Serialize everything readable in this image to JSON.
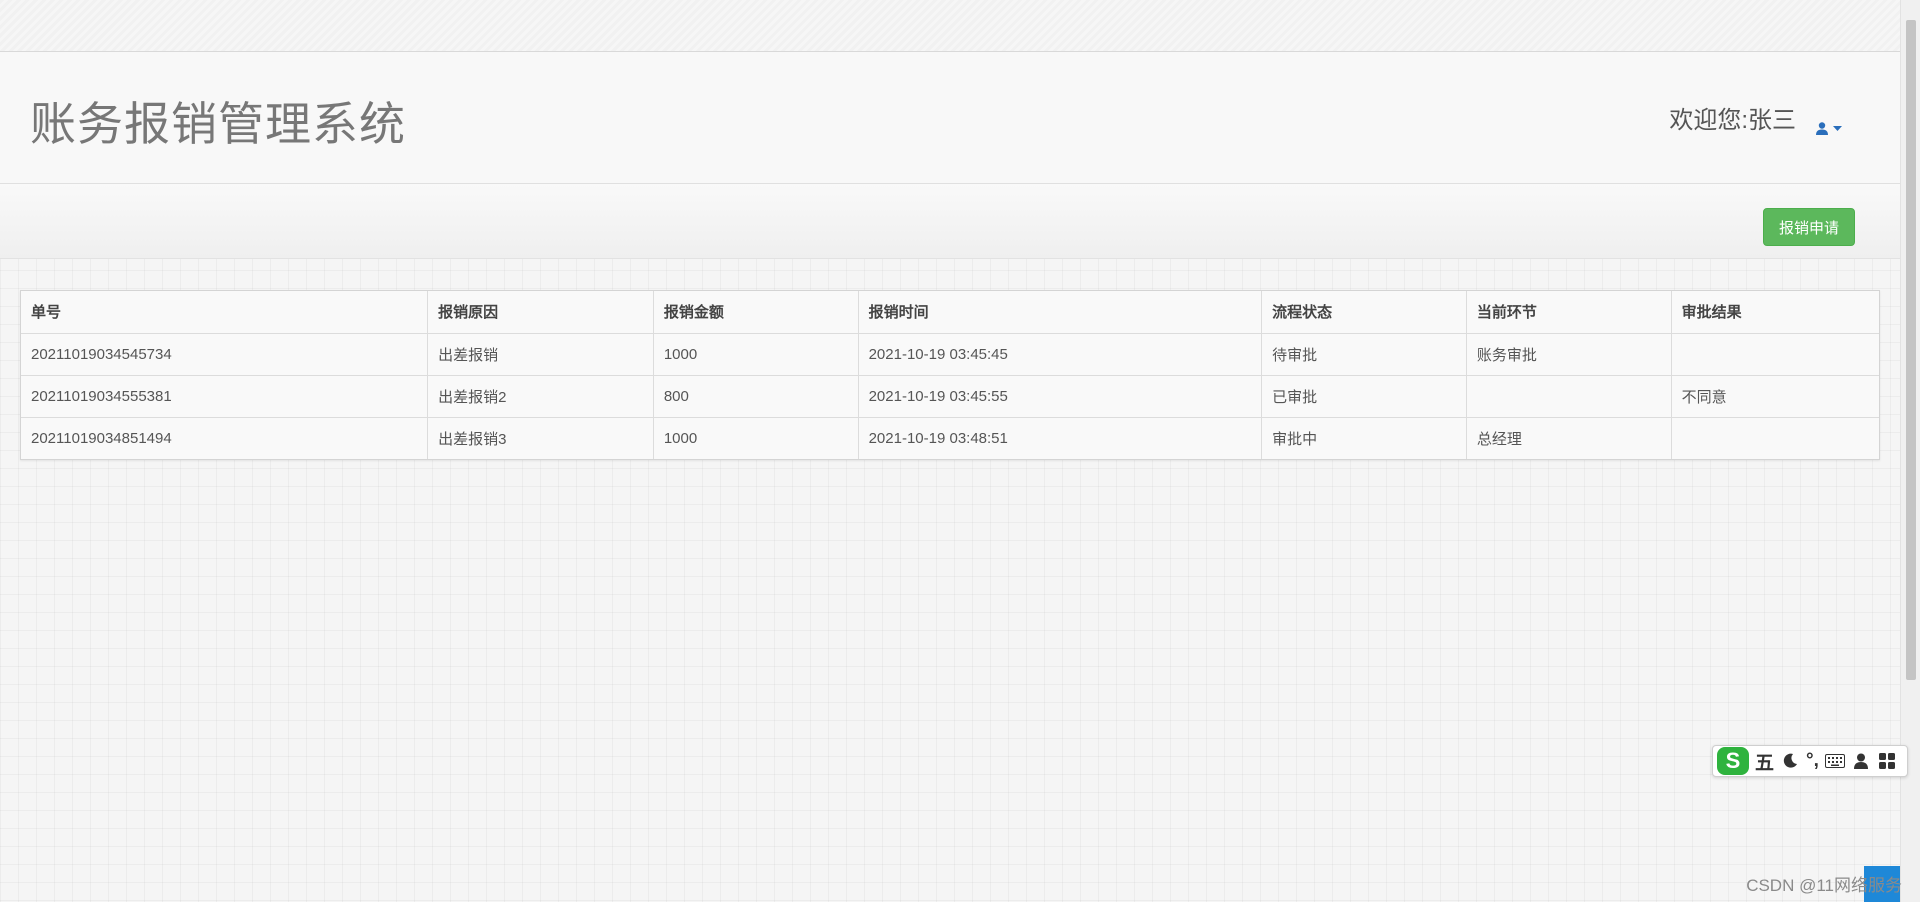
{
  "app": {
    "title": "账务报销管理系统",
    "welcome": "欢迎您:张三"
  },
  "toolbar": {
    "apply_label": "报销申请"
  },
  "table": {
    "headers": [
      "单号",
      "报销原因",
      "报销金额",
      "报销时间",
      "流程状态",
      "当前环节",
      "审批结果"
    ],
    "rows": [
      [
        "20211019034545734",
        "出差报销",
        "1000",
        "2021-10-19 03:45:45",
        "待审批",
        "账务审批",
        ""
      ],
      [
        "20211019034555381",
        "出差报销2",
        "800",
        "2021-10-19 03:45:55",
        "已审批",
        "",
        "不同意"
      ],
      [
        "20211019034851494",
        "出差报销3",
        "1000",
        "2021-10-19 03:48:51",
        "审批中",
        "总经理",
        ""
      ]
    ]
  },
  "ime": {
    "logo": "S",
    "mode": "五",
    "punct": "°,",
    "icons": [
      "moon-icon",
      "keyboard-icon",
      "user-icon",
      "grid-icon"
    ]
  },
  "watermark": "CSDN @11网络服务",
  "colors": {
    "primary_green": "#5cb85c",
    "user_icon_blue": "#2a6ebb",
    "ime_green": "#2fb33e",
    "corner_blue": "#1e88d8"
  }
}
